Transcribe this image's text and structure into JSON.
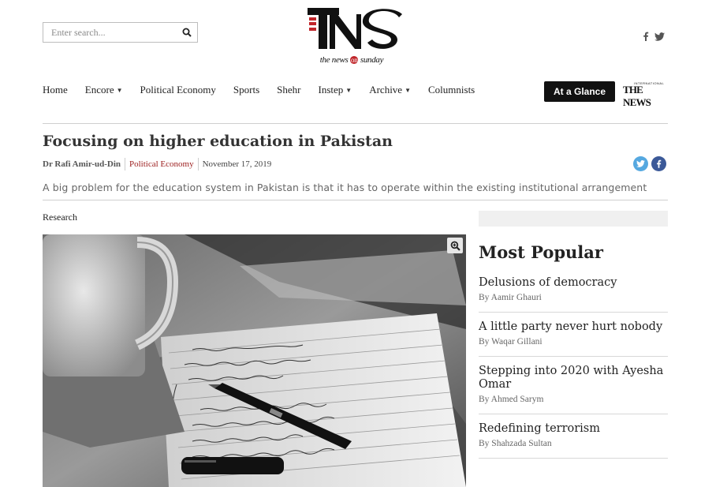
{
  "search": {
    "placeholder": "Enter search..."
  },
  "logo": {
    "letters": "TNS",
    "tagline_prefix": "the news ",
    "tagline_on": "on",
    "tagline_suffix": " sunday"
  },
  "nav": {
    "items": [
      {
        "label": "Home",
        "dropdown": false
      },
      {
        "label": "Encore",
        "dropdown": true
      },
      {
        "label": "Political Economy",
        "dropdown": false
      },
      {
        "label": "Sports",
        "dropdown": false
      },
      {
        "label": "Shehr",
        "dropdown": false
      },
      {
        "label": "Instep",
        "dropdown": true
      },
      {
        "label": "Archive",
        "dropdown": true
      },
      {
        "label": "Columnists",
        "dropdown": false
      }
    ],
    "glance_label": "At a Glance",
    "thenews_small": "INTERNATIONAL",
    "thenews_big": "THE NEWS"
  },
  "article": {
    "title": "Focusing on higher education in Pakistan",
    "author": "Dr Rafi Amir-ud-Din",
    "category": "Political Economy",
    "date": "November 17, 2019",
    "summary": "A big problem for the education system in Pakistan is that it has to operate within the existing institutional arrangement",
    "section": "Research"
  },
  "sidebar": {
    "heading": "Most Popular",
    "items": [
      {
        "title": "Delusions of democracy",
        "author": "By Aamir Ghauri"
      },
      {
        "title": "A little party never hurt nobody",
        "author": "By Waqar Gillani"
      },
      {
        "title": "Stepping into 2020 with Ayesha Omar",
        "author": "By Ahmed Sarym"
      },
      {
        "title": "Redefining terrorism",
        "author": "By Shahzada Sultan"
      }
    ]
  },
  "colors": {
    "brand_red": "#9b1c1c",
    "twitter": "#55a8e0",
    "facebook": "#3b5998",
    "button_dark": "#111111"
  },
  "icons": [
    "search-icon",
    "facebook-icon",
    "twitter-icon",
    "zoom-icon",
    "caret-down-icon"
  ]
}
